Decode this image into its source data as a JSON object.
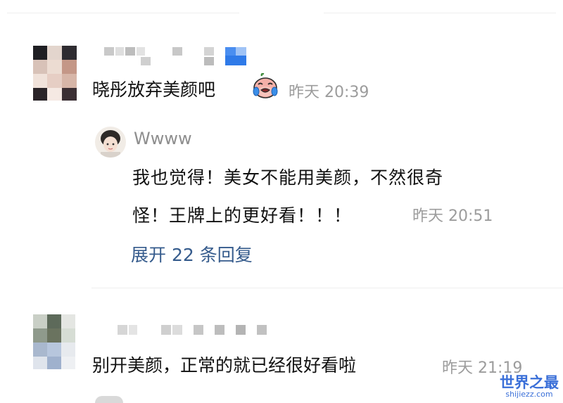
{
  "comments": [
    {
      "id": "c1",
      "text": "晓彤放弃美颜吧",
      "emoji": "crying-face-emoji",
      "time": "昨天 20:39",
      "reply": {
        "username": "Wwww",
        "line1": "我也觉得！美女不能用美颜，不然很奇",
        "line2": "怪！王牌上的更好看！！！",
        "time": "昨天 20:51"
      },
      "expand_label": "展开 22 条回复"
    },
    {
      "id": "c2",
      "text": "别开美颜，正常的就已经很好看啦",
      "time": "昨天 21:19"
    }
  ],
  "watermark": {
    "title": "世界之最",
    "url": "shijiezz.com"
  },
  "colors": {
    "link": "#355b8c",
    "timestamp": "#9c9c9c",
    "text": "#111111",
    "watermark": "#3a6fd8"
  }
}
